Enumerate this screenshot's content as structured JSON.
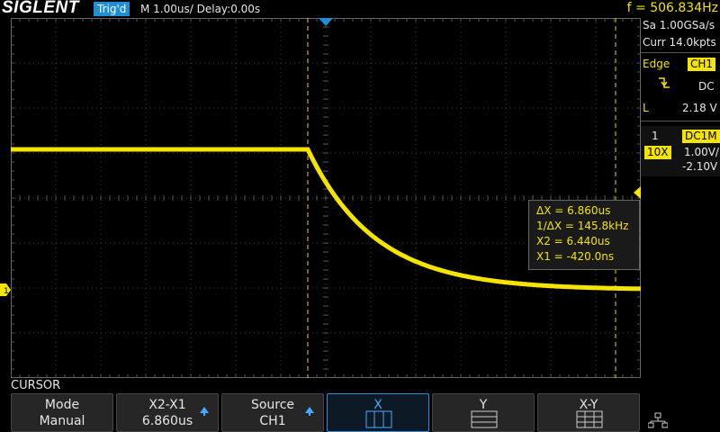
{
  "header": {
    "brand": "SIGLENT",
    "trigger_state": "Trig'd",
    "timebase": "M 1.00us/",
    "delay": "Delay:0.00s",
    "frequency": "f = 506.834Hz"
  },
  "acquisition": {
    "sample_rate": "Sa 1.00GSa/s",
    "memory_depth": "Curr 14.0kpts"
  },
  "trigger": {
    "type": "Edge",
    "source": "CH1",
    "coupling": "DC",
    "level_label": "L",
    "level": "2.18 V"
  },
  "channel1": {
    "number": "1",
    "coupling_impedance": "DC1M",
    "probe": "10X",
    "scale": "1.00V/",
    "offset": "-2.10V"
  },
  "markers": {
    "channel_marker": "1"
  },
  "cursor_readout": {
    "delta_x": "ΔX = 6.860us",
    "inv_delta_x": "1/ΔX = 145.8kHz",
    "x2": "X2 = 6.440us",
    "x1": "X1 = -420.0ns"
  },
  "menu": {
    "title": "CURSOR",
    "softkeys": [
      {
        "label": "Mode",
        "value": "Manual"
      },
      {
        "label": "X2-X1",
        "value": "6.860us"
      },
      {
        "label": "Source",
        "value": "CH1"
      },
      {
        "label": "X",
        "value": ""
      },
      {
        "label": "Y",
        "value": ""
      },
      {
        "label": "X-Y",
        "value": ""
      }
    ]
  },
  "colors": {
    "trace": "#f5e400",
    "accent": "#1e8fd6",
    "cursor_line": "#e8d800"
  }
}
